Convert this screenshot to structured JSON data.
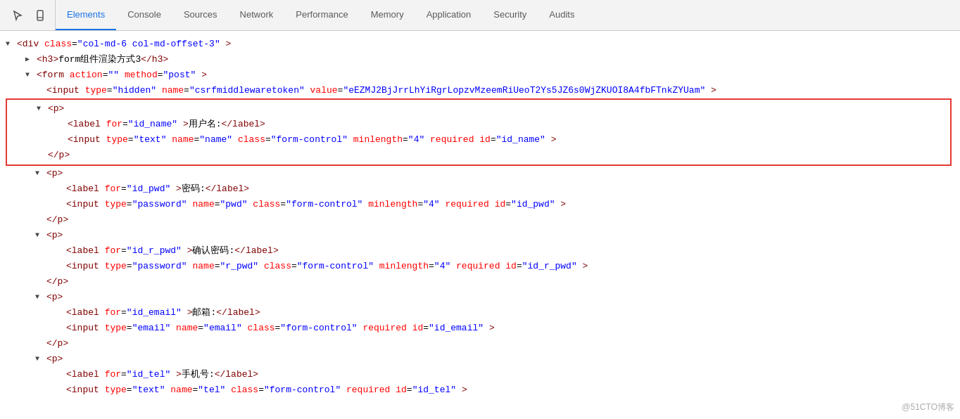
{
  "toolbar": {
    "tabs": [
      {
        "id": "elements",
        "label": "Elements",
        "active": true
      },
      {
        "id": "console",
        "label": "Console",
        "active": false
      },
      {
        "id": "sources",
        "label": "Sources",
        "active": false
      },
      {
        "id": "network",
        "label": "Network",
        "active": false
      },
      {
        "id": "performance",
        "label": "Performance",
        "active": false
      },
      {
        "id": "memory",
        "label": "Memory",
        "active": false
      },
      {
        "id": "application",
        "label": "Application",
        "active": false
      },
      {
        "id": "security",
        "label": "Security",
        "active": false
      },
      {
        "id": "audits",
        "label": "Audits",
        "active": false
      }
    ]
  },
  "watermark": "@51CTO博客",
  "icons": {
    "cursor": "⊹",
    "mobile": "▭"
  }
}
